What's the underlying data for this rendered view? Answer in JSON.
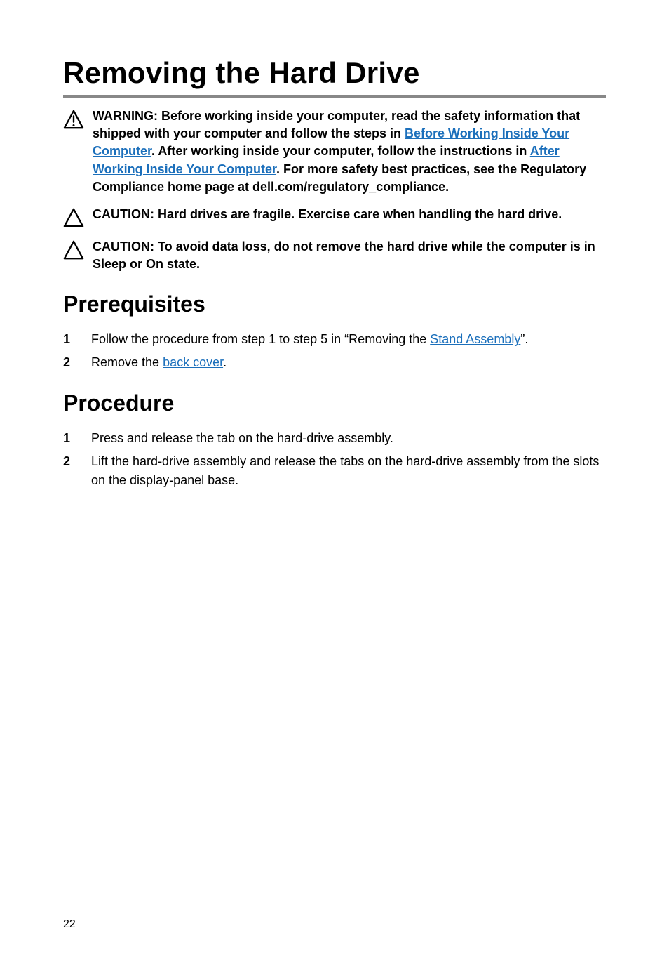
{
  "title": "Removing the Hard Drive",
  "warning": {
    "pre": "WARNING: Before working inside your computer, read the safety information that shipped with your computer and follow the steps in ",
    "link1": "Before Working Inside Your Computer",
    "mid1": ". After working inside your computer, follow the instructions in ",
    "link2": "After Working Inside Your Computer",
    "post": ". For more safety best practices, see the Regulatory Compliance home page at dell.com/regulatory_compliance."
  },
  "caution1": "CAUTION: Hard drives are fragile. Exercise care when handling the hard drive.",
  "caution2": "CAUTION: To avoid data loss, do not remove the hard drive while the computer is in Sleep or On state.",
  "sections": {
    "prereq_title": "Prerequisites",
    "procedure_title": "Procedure"
  },
  "prereq": {
    "step1_pre": "Follow the procedure from step 1 to step 5 in “Removing the ",
    "step1_link": "Stand Assembly",
    "step1_post": "”.",
    "step2_pre": "Remove the ",
    "step2_link": "back cover",
    "step2_post": "."
  },
  "procedure": {
    "step1": "Press and release the tab on the hard-drive assembly.",
    "step2": "Lift the hard-drive assembly and release the tabs on the hard-drive assembly from the slots on the display-panel base."
  },
  "page_number": "22"
}
